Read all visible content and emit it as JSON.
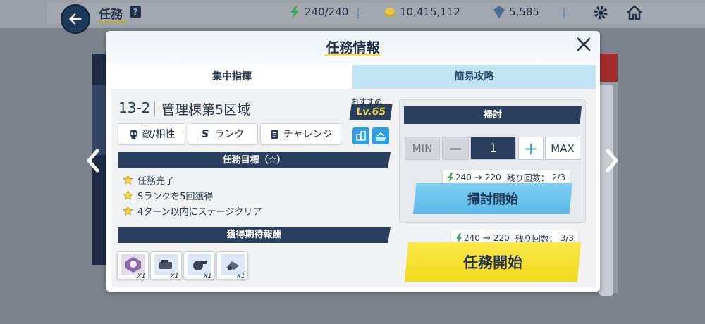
{
  "top_bar": {
    "screen_title": "任務",
    "help": "?",
    "stamina": "240/240",
    "credits": "10,415,112",
    "gems": "5,585"
  },
  "modal": {
    "title": "任務情報",
    "tabs": [
      {
        "label": "集中指揮"
      },
      {
        "label": "簡易攻略"
      }
    ],
    "stage": {
      "number": "13-2",
      "name": "管理棟第5区域",
      "recommended_label": "おすすめ",
      "recommended_level": "Lv.65"
    },
    "filter_chips": {
      "enemy": "敵/相性",
      "rank_letter": "S",
      "rank": "ランク",
      "challenge": "チャレンジ"
    },
    "objectives": {
      "header": "任務目標（☆）",
      "items": [
        "任務完了",
        "Sランクを5回獲得",
        "4ターン以内にステージクリア"
      ]
    },
    "rewards": {
      "header": "獲得期待報酬",
      "items": [
        {
          "count": "x1"
        },
        {
          "count": "x1"
        },
        {
          "count": "x1"
        },
        {
          "count": "x1"
        }
      ]
    },
    "sweep": {
      "header": "掃討",
      "min": "MIN",
      "minus": "−",
      "quantity": "1",
      "plus": "+",
      "max": "MAX",
      "stamina_from": "240",
      "arrow": "→",
      "stamina_to": "220",
      "remaining_label": "残り回数：",
      "remaining_value": "2/3",
      "start_label": "掃討開始"
    },
    "mission": {
      "stamina_from": "240",
      "arrow": "→",
      "stamina_to": "220",
      "remaining_label": "残り回数：",
      "remaining_value": "3/3",
      "start_label": "任務開始"
    }
  },
  "colors": {
    "navy": "#2a3e5e",
    "accent_yellow": "#f3e24b",
    "sweep_blue": "#5ab8e8",
    "tab_blue": "#bfe3f3"
  }
}
